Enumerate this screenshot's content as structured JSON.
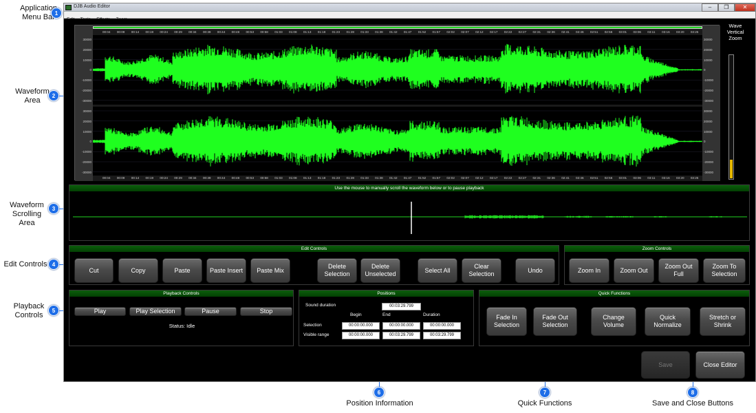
{
  "callouts": {
    "c1": {
      "num": "1",
      "line1": "Application",
      "line2": "Menu Bar"
    },
    "c2": {
      "num": "2",
      "line1": "Waveform",
      "line2": "Area"
    },
    "c3": {
      "num": "3",
      "line1": "Waveform",
      "line2": "Scrolling Area"
    },
    "c4": {
      "num": "4",
      "line1": "Edit Controls"
    },
    "c5": {
      "num": "5",
      "line1": "Playback",
      "line2": "Controls"
    },
    "c6": {
      "num": "6",
      "line1": "Position Information"
    },
    "c7": {
      "num": "7",
      "line1": "Quick Functions"
    },
    "c8": {
      "num": "8",
      "line1": "Save and Close Buttons"
    }
  },
  "window": {
    "title": "DJB Audio Editor",
    "min_glyph": "–",
    "restore_glyph": "❐",
    "close_glyph": "✕"
  },
  "menu": [
    "Edit",
    "Tools",
    "Effects",
    "Zoom"
  ],
  "wave": {
    "time_ticks": [
      "00:04",
      "00:09",
      "00:14",
      "00:19",
      "00:24",
      "00:29",
      "00:34",
      "00:39",
      "00:44",
      "00:48",
      "00:53",
      "00:58",
      "01:03",
      "01:08",
      "01:13",
      "01:18",
      "01:23",
      "01:28",
      "01:33",
      "01:38",
      "01:42",
      "01:47",
      "01:52",
      "01:57",
      "02:02",
      "02:07",
      "02:12",
      "02:17",
      "02:22",
      "02:27",
      "02:31",
      "02:36",
      "02:41",
      "02:46",
      "02:51",
      "02:56",
      "03:01",
      "03:06",
      "03:11",
      "03:16",
      "03:20",
      "03:25"
    ],
    "y_ticks": [
      "30000",
      "20000",
      "10000",
      "0",
      "-10000",
      "-20000",
      "-30000"
    ],
    "wave_color": "#1fff1f"
  },
  "vertical_zoom": {
    "line1": "Wave",
    "line2": "Vertical Zoom",
    "level": 0.15
  },
  "scroll_area": {
    "header": "Use the mouse to manually scroll the waveform below or to pause playback"
  },
  "edit_controls": {
    "header": "Edit Controls",
    "cut": "Cut",
    "copy": "Copy",
    "paste": "Paste",
    "paste_insert": "Paste Insert",
    "paste_mix": "Paste Mix",
    "delete_selection": "Delete Selection",
    "delete_unselected": "Delete Unselected",
    "select_all": "Select All",
    "clear_selection": "Clear Selection",
    "undo": "Undo"
  },
  "zoom_controls": {
    "header": "Zoom Controls",
    "zoom_in": "Zoom In",
    "zoom_out": "Zoom Out",
    "zoom_out_full": "Zoom Out Full",
    "zoom_to_selection": "Zoom To Selection"
  },
  "playback": {
    "header": "Playback Controls",
    "play": "Play",
    "play_selection": "Play Selection",
    "pause": "Pause",
    "stop": "Stop",
    "status": "Status: Idle"
  },
  "positions": {
    "header": "Positions",
    "sound_duration_label": "Sound duration",
    "sound_duration": "00:03:29.799",
    "col_begin": "Begin",
    "col_end": "End",
    "col_duration": "Duration",
    "selection_label": "Selection",
    "selection_begin": "00:00:00.000",
    "selection_end": "00:00:00.000",
    "selection_duration": "00:00:00.000",
    "visible_label": "Visible range",
    "visible_begin": "00:00:00.000",
    "visible_end": "00:03:29.799",
    "visible_duration": "00:03:29.799"
  },
  "quick_functions": {
    "header": "Quick Functions",
    "fade_in": "Fade In Selection",
    "fade_out": "Fade Out Selection",
    "change_volume": "Change Volume",
    "quick_normalize": "Quick Normalize",
    "stretch": "Stretch or Shrink"
  },
  "footer": {
    "save": "Save",
    "close_editor": "Close Editor"
  }
}
